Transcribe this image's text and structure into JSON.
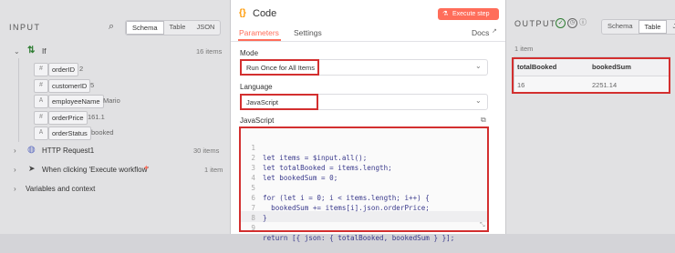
{
  "input_panel": {
    "title": "INPUT",
    "view_tabs": [
      "Schema",
      "Table",
      "JSON"
    ],
    "if_node": {
      "label": "If",
      "count": "16 items"
    },
    "fields": [
      {
        "type": "#",
        "name": "orderID",
        "value": "2"
      },
      {
        "type": "#",
        "name": "customerID",
        "value": "5"
      },
      {
        "type": "A",
        "name": "employeeName",
        "value": "Mario"
      },
      {
        "type": "#",
        "name": "orderPrice",
        "value": "161.1"
      },
      {
        "type": "A",
        "name": "orderStatus",
        "value": "booked"
      }
    ],
    "http_node": {
      "label": "HTTP Request1",
      "count": "30 items"
    },
    "trigger_node": {
      "label": "When clicking 'Execute workflow'",
      "count": "1 item"
    },
    "variables": {
      "label": "Variables and context"
    }
  },
  "code_panel": {
    "icon": "{}",
    "title": "Code",
    "execute_label": "Execute step",
    "tabs": [
      "Parameters",
      "Settings"
    ],
    "docs_label": "Docs",
    "mode_label": "Mode",
    "mode_value": "Run Once for All Items",
    "language_label": "Language",
    "language_value": "JavaScript",
    "code_label": "JavaScript",
    "code_lines": [
      {
        "n": "1",
        "text": "let items = $input.all();"
      },
      {
        "n": "2",
        "text": "let totalBooked = items.length;"
      },
      {
        "n": "3",
        "text": "let bookedSum = 0;"
      },
      {
        "n": "4",
        "text": ""
      },
      {
        "n": "5",
        "text": "for (let i = 0; i < items.length; i++) {"
      },
      {
        "n": "6",
        "text": "  bookedSum += items[i].json.orderPrice;"
      },
      {
        "n": "7",
        "text": "}"
      },
      {
        "n": "8",
        "text": ""
      },
      {
        "n": "9",
        "text": "return [{ json: { totalBooked, bookedSum } }];"
      }
    ]
  },
  "output_panel": {
    "title": "OUTPUT",
    "view_tabs": [
      "Schema",
      "Table",
      "J"
    ],
    "count": "1 item",
    "columns": [
      "totalBooked",
      "bookedSum"
    ],
    "rows": [
      [
        "16",
        "2251.14"
      ]
    ]
  },
  "colors": {
    "accent": "#ff6d5a",
    "highlight": "#d32f2f"
  }
}
